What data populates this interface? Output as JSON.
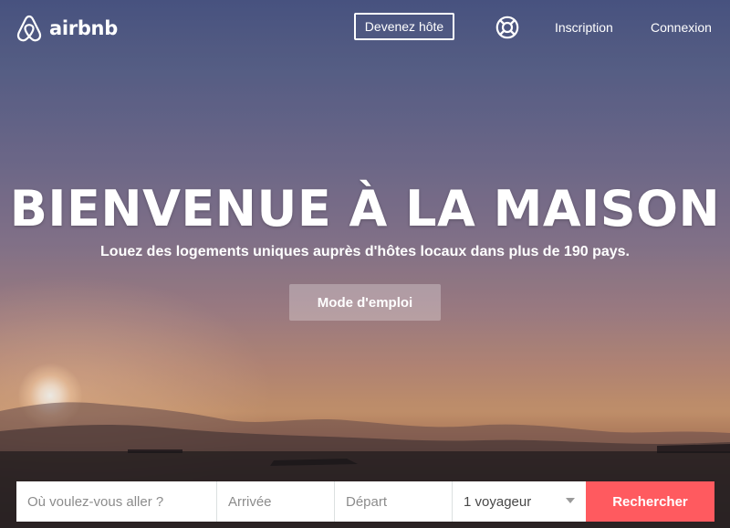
{
  "header": {
    "brand": "airbnb",
    "logo_icon": "airbnb-belo-icon",
    "become_host_label": "Devenez hôte",
    "help_icon": "lifebuoy-icon",
    "signup_label": "Inscription",
    "login_label": "Connexion"
  },
  "hero": {
    "title": "BIENVENUE À LA MAISON",
    "subtitle": "Louez des logements uniques auprès d'hôtes locaux dans plus de 190 pays.",
    "how_it_works_label": "Mode d'emploi"
  },
  "search": {
    "destination_placeholder": "Où voulez-vous aller ?",
    "checkin_placeholder": "Arrivée",
    "checkout_placeholder": "Départ",
    "guests_value": "1 voyageur",
    "submit_label": "Rechercher"
  },
  "colors": {
    "brand_accent": "#ff5a5f",
    "text_on_hero": "#ffffff"
  }
}
